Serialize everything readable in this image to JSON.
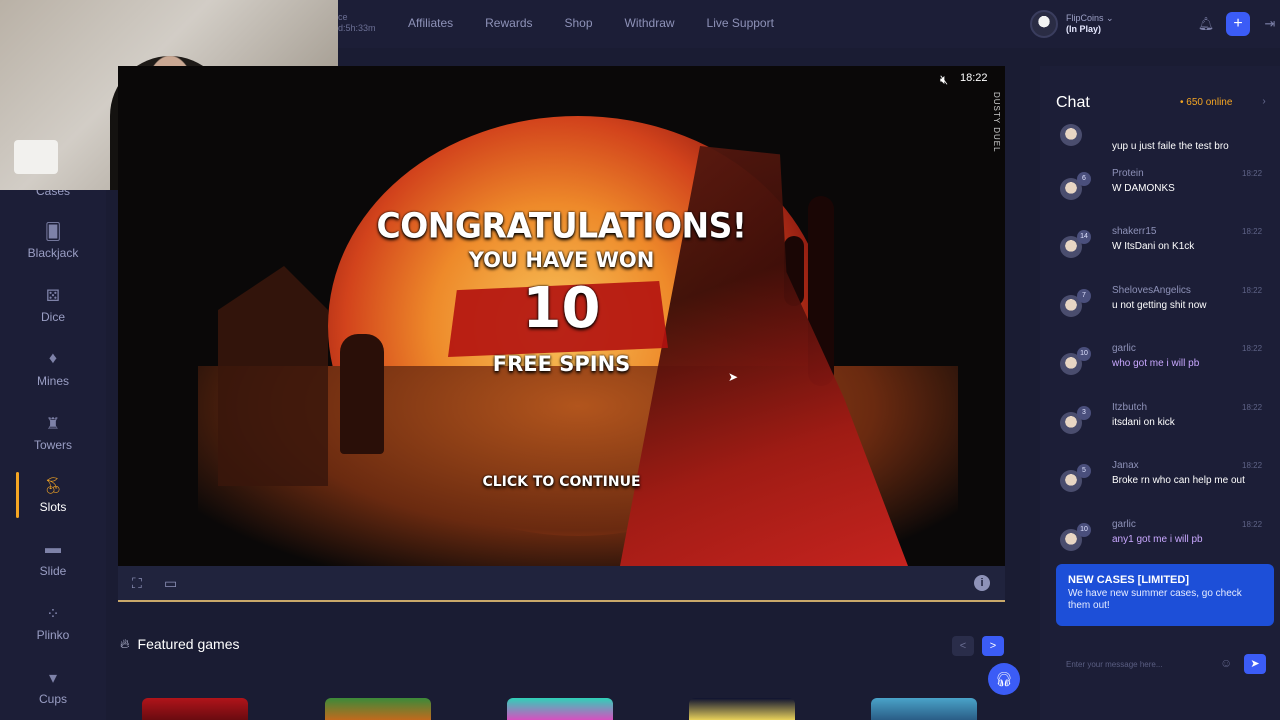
{
  "topbar": {
    "partial_text_1": "ce",
    "partial_text_2": "d:5h:33m",
    "nav": [
      "Affiliates",
      "Rewards",
      "Shop",
      "Withdraw",
      "Live Support"
    ],
    "user_name": "FlipCoins",
    "user_status": "(In Play)"
  },
  "sidebar": {
    "partial_label": "Cases",
    "items": [
      {
        "label": "Blackjack",
        "icon": "blackjack-icon"
      },
      {
        "label": "Dice",
        "icon": "dice-icon"
      },
      {
        "label": "Mines",
        "icon": "mines-icon"
      },
      {
        "label": "Towers",
        "icon": "towers-icon"
      },
      {
        "label": "Slots",
        "icon": "slots-icon",
        "active": true
      },
      {
        "label": "Slide",
        "icon": "slide-icon"
      },
      {
        "label": "Plinko",
        "icon": "plinko-icon"
      },
      {
        "label": "Cups",
        "icon": "cups-icon"
      }
    ]
  },
  "game": {
    "time": "18:22",
    "side_label": "DUSTY DUEL",
    "line1": "CONGRATULATIONS!",
    "line2": "YOU HAVE WON",
    "spins": "10",
    "line4": "FREE SPINS",
    "continue": "CLICK TO CONTINUE"
  },
  "featured": {
    "title": "Featured games"
  },
  "chat": {
    "title": "Chat",
    "online": "• 650 online",
    "messages": [
      {
        "user": "",
        "level": "",
        "time": "",
        "text": "yup u just faile the test bro",
        "purple": false
      },
      {
        "user": "Protein",
        "level": "6",
        "time": "18:22",
        "text": "W DAMONKS",
        "purple": false
      },
      {
        "user": "shakerr15",
        "level": "14",
        "time": "18:22",
        "text": "W ItsDani on K1ck",
        "purple": false
      },
      {
        "user": "ShelovesAngelics",
        "level": "7",
        "time": "18:22",
        "text": "u not getting shit now",
        "purple": false
      },
      {
        "user": "garlic",
        "level": "10",
        "time": "18:22",
        "text": "who got me i will pb",
        "purple": true
      },
      {
        "user": "Itzbutch",
        "level": "3",
        "time": "18:22",
        "text": "itsdani on kick",
        "purple": false
      },
      {
        "user": "Janax",
        "level": "5",
        "time": "18:22",
        "text": "Broke rn who can help me out",
        "purple": false
      },
      {
        "user": "garlic",
        "level": "10",
        "time": "18:22",
        "text": "any1 got me i will pb",
        "purple": true
      }
    ],
    "announcement_title": "NEW CASES [LIMITED]",
    "announcement_body": "We have new summer cases, go check them out!",
    "input_placeholder": "Enter your message here..."
  },
  "colors": {
    "accent": "#3b5cf6",
    "active": "#f5a623",
    "background": "#1a1c33"
  }
}
